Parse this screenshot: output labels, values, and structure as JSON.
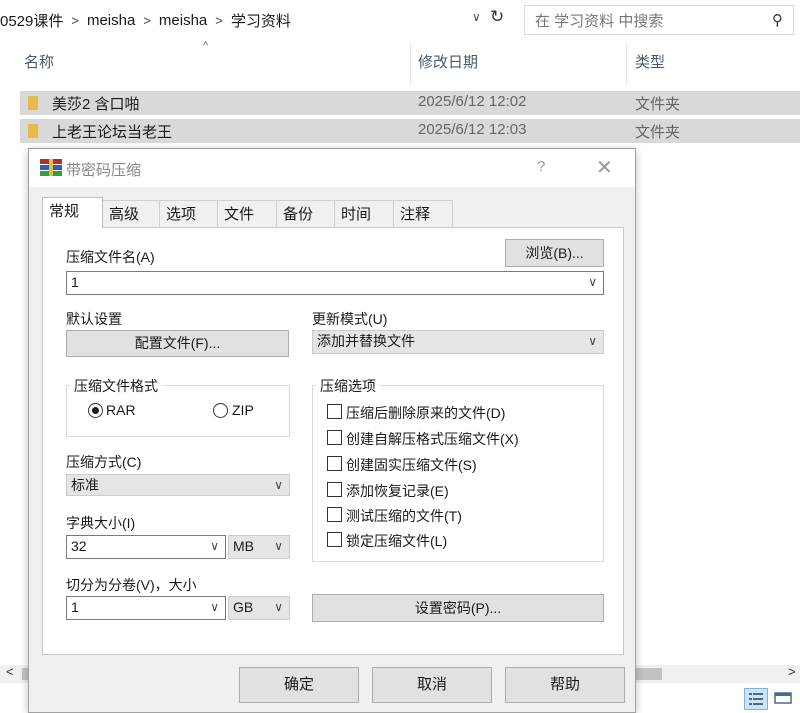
{
  "explorer": {
    "breadcrumb": [
      "0529课件",
      "meisha",
      "meisha",
      "学习资料"
    ],
    "search_placeholder": "在 学习资料 中搜索",
    "columns": {
      "name": "名称",
      "date": "修改日期",
      "type": "类型"
    },
    "files": [
      {
        "name": "美莎2 含口啪",
        "date": "2025/6/12 12:02",
        "type": "文件夹"
      },
      {
        "name": "上老王论坛当老王",
        "date": "2025/6/12 12:03",
        "type": "文件夹"
      }
    ]
  },
  "dialog": {
    "title": "带密码压缩",
    "help": "?",
    "close": "✕",
    "tabs": [
      "常规",
      "高级",
      "选项",
      "文件",
      "备份",
      "时间",
      "注释"
    ],
    "archive_name_label": "压缩文件名(A)",
    "browse_label": "浏览(B)...",
    "archive_name_value": "1",
    "default_settings_label": "默认设置",
    "profiles_label": "配置文件(F)...",
    "update_mode_label": "更新模式(U)",
    "update_mode_value": "添加并替换文件",
    "format_label": "压缩文件格式",
    "format_rar": "RAR",
    "format_zip": "ZIP",
    "method_label": "压缩方式(C)",
    "method_value": "标准",
    "dict_label": "字典大小(I)",
    "dict_value": "32",
    "dict_unit": "MB",
    "split_label": "切分为分卷(V)，大小",
    "split_value": "1",
    "split_unit": "GB",
    "options_label": "压缩选项",
    "options": [
      "压缩后删除原来的文件(D)",
      "创建自解压格式压缩文件(X)",
      "创建固实压缩文件(S)",
      "添加恢复记录(E)",
      "测试压缩的文件(T)",
      "锁定压缩文件(L)"
    ],
    "set_password_label": "设置密码(P)...",
    "ok_label": "确定",
    "cancel_label": "取消",
    "help_label": "帮助"
  }
}
